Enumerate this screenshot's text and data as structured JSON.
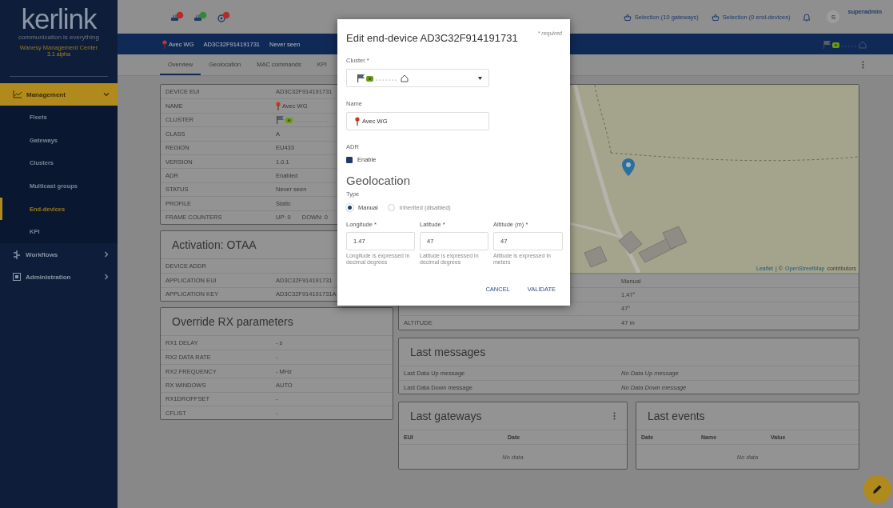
{
  "sidebar": {
    "logo": "kerlink",
    "tagline": "communication is everything",
    "product": "Wanesy Management Center",
    "version": "3.1 alpha",
    "items": [
      {
        "label": "Management",
        "selected": true,
        "expanded": true,
        "children": [
          {
            "label": "Fleets",
            "selected": false
          },
          {
            "label": "Gateways",
            "selected": false
          },
          {
            "label": "Clusters",
            "selected": false
          },
          {
            "label": "Multicast groups",
            "selected": false
          },
          {
            "label": "End-devices",
            "selected": true
          },
          {
            "label": "KPI",
            "selected": false
          }
        ]
      },
      {
        "label": "Workflows",
        "selected": false,
        "expanded": false
      },
      {
        "label": "Administration",
        "selected": false,
        "expanded": false
      }
    ]
  },
  "topbar": {
    "selections": [
      "Selection (10 gateways)",
      "Selection (0 end-devices)"
    ],
    "avatar": "S",
    "user": "superadmin"
  },
  "device_bar": {
    "name": "Avec WG",
    "eui": "AD3C32F914191731",
    "status": "Never seen"
  },
  "tabs": [
    {
      "label": "Overview",
      "selected": true
    },
    {
      "label": "Geolocation",
      "selected": false
    },
    {
      "label": "MAC commands",
      "selected": false
    },
    {
      "label": "KPI",
      "selected": false
    }
  ],
  "device_table": {
    "rows": [
      {
        "label": "DEVICE EUI",
        "kind": "text",
        "value": "AD3C32F914191731"
      },
      {
        "label": "NAME",
        "kind": "pin",
        "value": "Avec WG"
      },
      {
        "label": "CLUSTER",
        "kind": "cluster"
      },
      {
        "label": "CLASS",
        "kind": "text",
        "value": "A"
      },
      {
        "label": "REGION",
        "kind": "text",
        "value": "EU433"
      },
      {
        "label": "VERSION",
        "kind": "text",
        "value": "1.0.1"
      },
      {
        "label": "ADR",
        "kind": "text",
        "value": "Enabled"
      },
      {
        "label": "STATUS",
        "kind": "text",
        "value": "Never seen"
      },
      {
        "label": "PROFILE",
        "kind": "text",
        "value": "Static"
      },
      {
        "label": "FRAME COUNTERS",
        "kind": "pair",
        "values": [
          "UP: 0",
          "DOWN: 0"
        ]
      }
    ]
  },
  "activation": {
    "title": "Activation: OTAA",
    "rows": [
      {
        "label": "DEVICE ADDR",
        "kind": "text"
      },
      {
        "label": "APPLICATION EUI",
        "kind": "text",
        "value": "AD3C32F914191731"
      },
      {
        "label": "APPLICATION KEY",
        "kind": "text",
        "value": "AD3C32F914191731A"
      }
    ]
  },
  "rx_parameters": {
    "title": "Override RX parameters",
    "rows": [
      {
        "label": "RX1 DELAY",
        "kind": "text",
        "value": "- s"
      },
      {
        "label": "RX2 DATA RATE",
        "kind": "text",
        "value": "-"
      },
      {
        "label": "RX2 FREQUENCY",
        "kind": "text",
        "value": "- MHz"
      },
      {
        "label": "RX WINDOWS",
        "kind": "text",
        "value": "AUTO"
      },
      {
        "label": "RX1DROFFSET",
        "kind": "text",
        "value": "-"
      },
      {
        "label": "CFLIST",
        "kind": "text",
        "value": "-"
      }
    ]
  },
  "map_card": {
    "attribution": [
      {
        "text": "Leaflet",
        "link": true
      },
      {
        "text": "| ©",
        "link": false
      },
      {
        "text": "OpenStreetMap",
        "link": true
      },
      {
        "text": "contributors",
        "link": false
      }
    ],
    "rows": [
      {
        "value": "Manual"
      },
      {
        "value": "1.47°"
      },
      {
        "value": "47°"
      },
      {
        "label": "ALTITUDE",
        "value": "47 m"
      }
    ]
  },
  "last_messages": {
    "title": "Last messages",
    "rows": [
      {
        "label": "Last Data Up message",
        "value": "No Data Up message"
      },
      {
        "label": "Last Data Down message",
        "value": "No Data Down message"
      }
    ]
  },
  "last_gateways": {
    "title": "Last gateways",
    "columns": [
      "EUI",
      "Date"
    ],
    "empty": "No data"
  },
  "last_events": {
    "title": "Last events",
    "columns": [
      "Date",
      "Name",
      "Value"
    ],
    "empty": "No data"
  },
  "dialog": {
    "title": "Edit end-device AD3C32F914191731",
    "required_note": "* required",
    "cluster": {
      "label": "Cluster *"
    },
    "name": {
      "label": "Name",
      "value": "Avec WG"
    },
    "adr": {
      "label": "ADR",
      "option": "Enable",
      "checked": true
    },
    "section": "Geolocation",
    "type": {
      "label": "Type",
      "options": [
        {
          "label": "Manual",
          "selected": true,
          "disabled": false
        },
        {
          "label": "Inherited (disabled)",
          "selected": false,
          "disabled": true
        }
      ]
    },
    "fields": [
      {
        "label": "Longitude *",
        "value": "1.47",
        "hint": "Longitude is expressed in decimal degrees"
      },
      {
        "label": "Latitude *",
        "value": "47",
        "hint": "Latitude is expressed in decimal degrees"
      },
      {
        "label": "Altitude (m) *",
        "value": "47",
        "hint": "Altitude is expressed in meters"
      }
    ],
    "buttons": [
      "CANCEL",
      "VALIDATE"
    ]
  }
}
